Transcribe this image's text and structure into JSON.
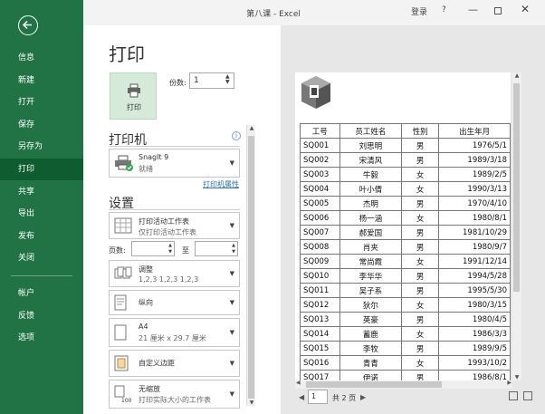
{
  "window": {
    "title": "第八课 - Excel",
    "login": "登录",
    "help": "?",
    "minimize": "—",
    "close": "✕"
  },
  "sidebar": {
    "items": [
      {
        "label": "信息"
      },
      {
        "label": "新建"
      },
      {
        "label": "打开"
      },
      {
        "label": "保存"
      },
      {
        "label": "另存为"
      },
      {
        "label": "打印"
      },
      {
        "label": "共享"
      },
      {
        "label": "导出"
      },
      {
        "label": "发布"
      },
      {
        "label": "关闭"
      },
      {
        "label": "帐户"
      },
      {
        "label": "反馈"
      },
      {
        "label": "选项"
      }
    ],
    "active": "打印"
  },
  "print": {
    "title": "打印",
    "button_label": "打印",
    "copies_label": "份数:",
    "copies_value": "1"
  },
  "printer": {
    "heading": "打印机",
    "name": "SnagIt 9",
    "status": "就绪",
    "properties_link": "打印机属性",
    "info": "i"
  },
  "settings": {
    "heading": "设置",
    "scope": {
      "title": "打印活动工作表",
      "subtitle": "仅打印活动工作表"
    },
    "pages_label": "页数:",
    "to_label": "至",
    "collate": {
      "title": "调整",
      "subtitle": "1,2,3    1,2,3    1,2,3"
    },
    "orientation": {
      "title": "纵向"
    },
    "paper": {
      "title": "A4",
      "subtitle": "21 厘米 x 29.7 厘米"
    },
    "margins": {
      "title": "自定义边距"
    },
    "scaling": {
      "title": "无缩放",
      "subtitle": "打印实际大小的工作表"
    }
  },
  "sheet": {
    "headers": [
      "工号",
      "员工姓名",
      "性别",
      "出生年月"
    ],
    "rows": [
      [
        "SQ001",
        "刘思明",
        "男",
        "1976/5/1"
      ],
      [
        "SQ002",
        "宋清风",
        "男",
        "1989/3/18"
      ],
      [
        "SQ003",
        "牛毅",
        "女",
        "1989/2/5"
      ],
      [
        "SQ004",
        "叶小倩",
        "女",
        "1990/3/13"
      ],
      [
        "SQ005",
        "杰明",
        "男",
        "1970/4/10"
      ],
      [
        "SQ006",
        "杨一涵",
        "女",
        "1980/8/1"
      ],
      [
        "SQ007",
        "郝爱国",
        "男",
        "1981/10/29"
      ],
      [
        "SQ008",
        "肖夹",
        "男",
        "1980/9/7"
      ],
      [
        "SQ009",
        "常尚霞",
        "女",
        "1991/12/14"
      ],
      [
        "SQ010",
        "李华华",
        "男",
        "1994/5/28"
      ],
      [
        "SQ011",
        "吴子系",
        "男",
        "1995/5/30"
      ],
      [
        "SQ012",
        "狄尔",
        "女",
        "1980/3/15"
      ],
      [
        "SQ013",
        "英豪",
        "男",
        "1980/4/5"
      ],
      [
        "SQ014",
        "蓄鹿",
        "女",
        "1986/3/3"
      ],
      [
        "SQ015",
        "李牧",
        "男",
        "1989/9/5"
      ],
      [
        "SQ016",
        "青青",
        "女",
        "1993/10/2"
      ],
      [
        "SQ017",
        "伊诺",
        "男",
        "1986/8/1"
      ]
    ]
  },
  "page_nav": {
    "current": "1",
    "total": "共 2 页",
    "prev": "◀",
    "next": "▶"
  },
  "colors": {
    "sidebar": "#217346",
    "sidebar_active": "#0e5c2f",
    "print_button": "#d6ead9",
    "link": "#2e6fb5"
  }
}
